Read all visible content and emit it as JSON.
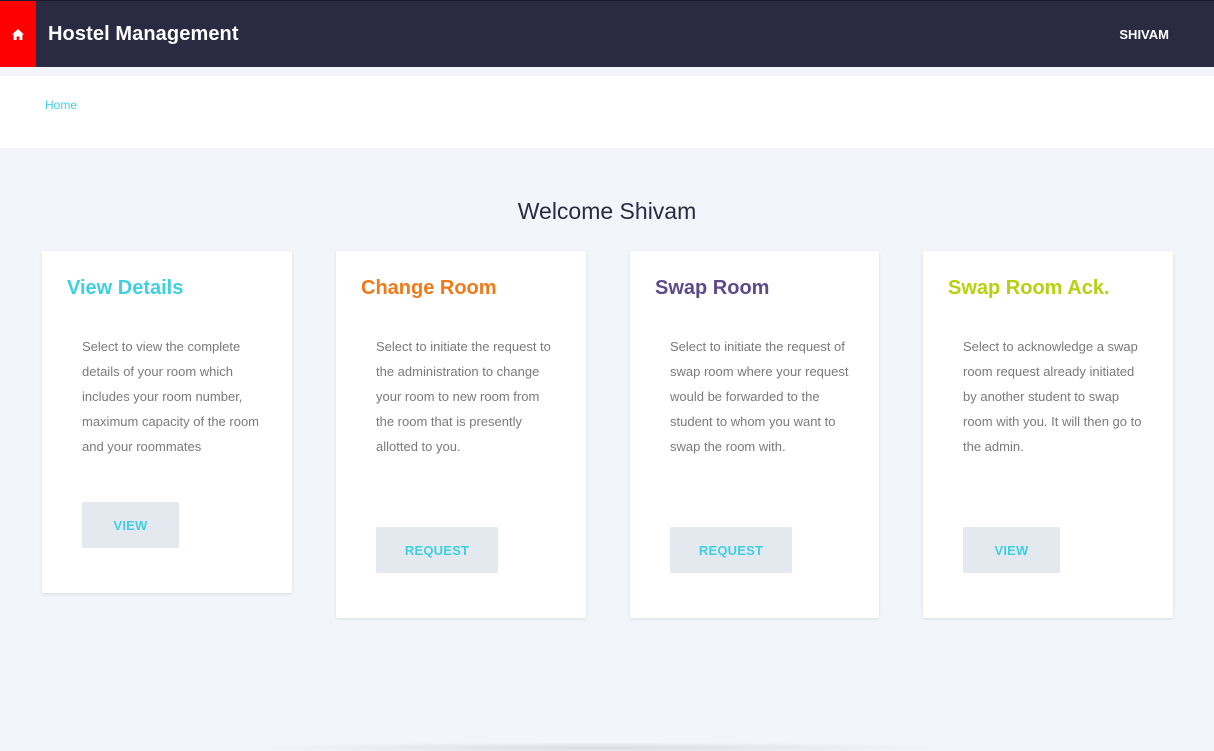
{
  "header": {
    "home_icon": "home-icon",
    "title": "Hostel Management",
    "user": "SHIVAM"
  },
  "breadcrumb": {
    "home": "Home"
  },
  "welcome": "Welcome Shivam",
  "cards": [
    {
      "title": "View Details",
      "color": "#3fd0e0",
      "description": "Select to view the complete details of your room which includes your room number, maximum capacity of the room and your roommates",
      "button": "VIEW"
    },
    {
      "title": "Change Room",
      "color": "#f07a1a",
      "description": "Select to initiate the request to the administration to change your room to new room from the room that is presently allotted to you.",
      "button": "REQUEST"
    },
    {
      "title": "Swap Room",
      "color": "#5b4b8a",
      "description": "Select to initiate the request of swap room where your request would be forwarded to the student to whom you want to swap the room with.",
      "button": "REQUEST"
    },
    {
      "title": "Swap Room Ack.",
      "color": "#b5d10f",
      "description": "Select to acknowledge a swap room request already initiated by another student to swap room with you. It will then go to the admin.",
      "button": "VIEW"
    }
  ],
  "colors": {
    "topbar": "#2b2a43",
    "home_button": "#ff0000",
    "accent": "#3fd0e0",
    "background": "#f2f6fa"
  }
}
